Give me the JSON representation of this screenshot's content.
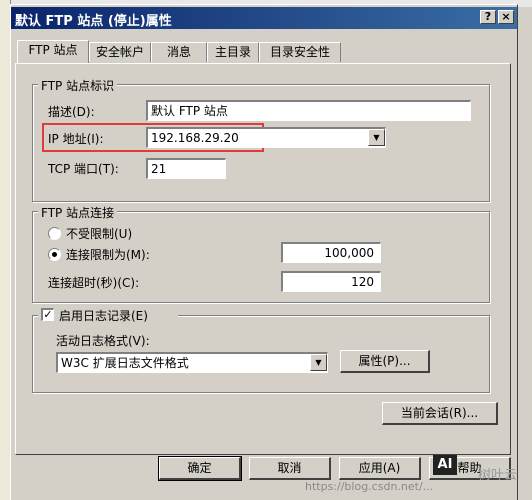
{
  "window": {
    "title": "默认 FTP 站点 (停止)属性",
    "help_btn": "?",
    "close_btn": "×"
  },
  "tabs": [
    {
      "label": "FTP 站点",
      "active": true
    },
    {
      "label": "安全帐户"
    },
    {
      "label": "消息"
    },
    {
      "label": "主目录"
    },
    {
      "label": "目录安全性"
    }
  ],
  "identification": {
    "legend": "FTP 站点标识",
    "desc_label": "描述(D):",
    "desc_value": "默认 FTP 站点",
    "ip_label": "IP 地址(I):",
    "ip_value": "192.168.29.20",
    "port_label": "TCP 端口(T):",
    "port_value": "21"
  },
  "connection": {
    "legend": "FTP 站点连接",
    "unlimited_label": "不受限制(U)",
    "limited_label": "连接限制为(M):",
    "limit_value": "100,000",
    "timeout_label": "连接超时(秒)(C):",
    "timeout_value": "120"
  },
  "logging": {
    "enable_label": "启用日志记录(E)",
    "enabled": true,
    "format_label": "活动日志格式(V):",
    "format_value": "W3C 扩展日志文件格式",
    "props_button": "属性(P)..."
  },
  "current_sessions_button": "当前会话(R)...",
  "footer": {
    "ok": "确定",
    "cancel": "取消",
    "apply": "应用(A)",
    "help": "帮助"
  },
  "watermark": {
    "logo": "AI",
    "text": "https://blog.csdn.net/...",
    "side": "树叶云"
  },
  "colors": {
    "title_start": "#0a246a",
    "title_end": "#3a6ea5",
    "highlight": "#e03a3a",
    "face": "#d4d0c8"
  }
}
